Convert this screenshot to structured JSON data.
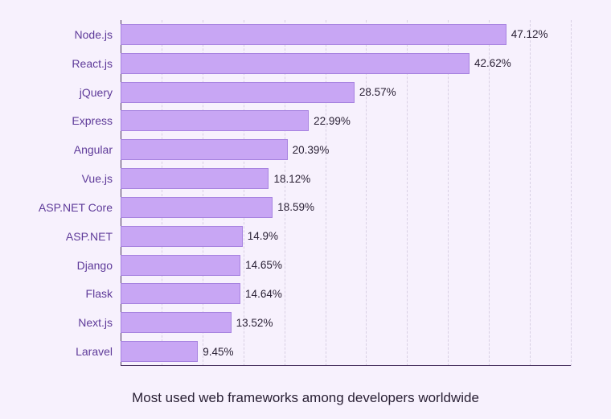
{
  "chart_data": {
    "type": "bar",
    "orientation": "horizontal",
    "categories": [
      "Node.js",
      "React.js",
      "jQuery",
      "Express",
      "Angular",
      "Vue.js",
      "ASP.NET Core",
      "ASP.NET",
      "Django",
      "Flask",
      "Next.js",
      "Laravel"
    ],
    "values": [
      47.12,
      42.62,
      28.57,
      22.99,
      20.39,
      18.12,
      18.59,
      14.9,
      14.65,
      14.64,
      13.52,
      9.45
    ],
    "value_labels": [
      "47.12%",
      "42.62%",
      "28.57%",
      "22.99%",
      "20.39%",
      "18.12%",
      "18.59%",
      "14.9%",
      "14.65%",
      "14.64%",
      "13.52%",
      "9.45%"
    ],
    "title": "Most used web frameworks among developers worldwide",
    "xlabel": "",
    "ylabel": "",
    "xlim": [
      0,
      55
    ],
    "grid_interval": 5,
    "bar_color": "#c8a6f4",
    "bar_border_color": "#a783e0",
    "text_color": "#5e3a99"
  }
}
